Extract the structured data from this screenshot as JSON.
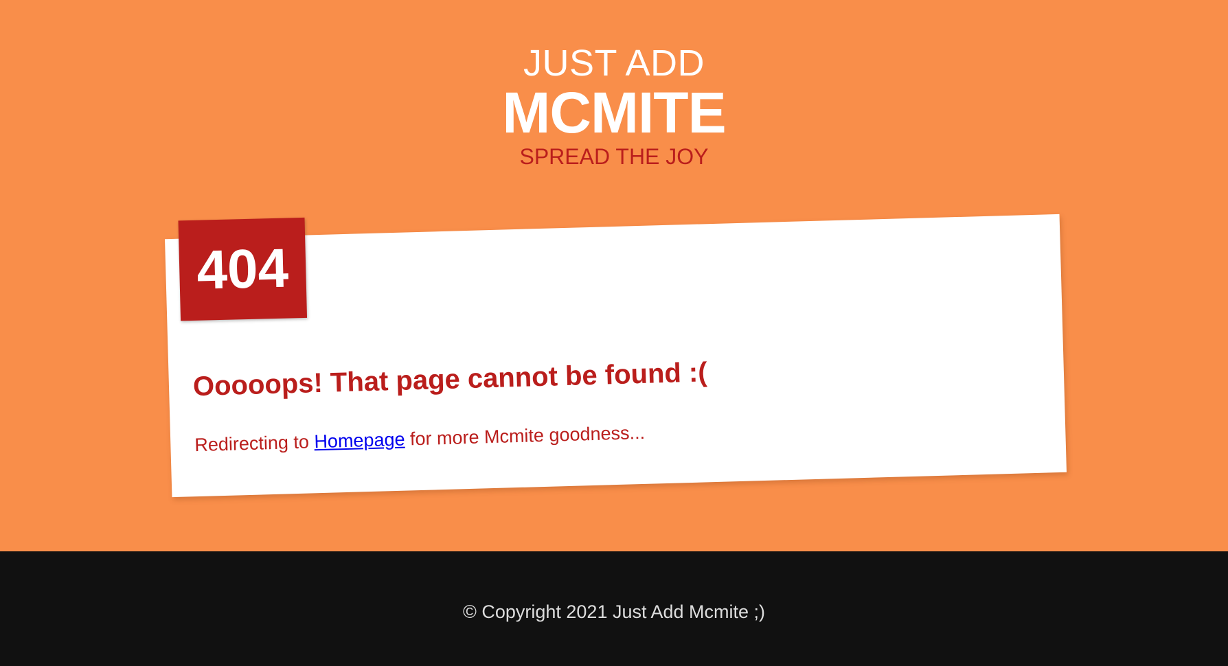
{
  "brand": {
    "top_line": "JUST ADD",
    "name": "MCMITE",
    "tagline": "SPREAD THE JOY"
  },
  "error": {
    "code": "404",
    "heading": "Ooooops! That page cannot be found :(",
    "redirect_prefix": "Redirecting to",
    "redirect_link": "Homepage",
    "redirect_suffix": "for more Mcmite goodness..."
  },
  "footer": {
    "copyright": "© Copyright 2021 Just Add Mcmite ;)"
  },
  "colors": {
    "background": "#F98E4A",
    "accent": "#BA1E1C",
    "footer": "#111111",
    "link": "#0000EE"
  }
}
